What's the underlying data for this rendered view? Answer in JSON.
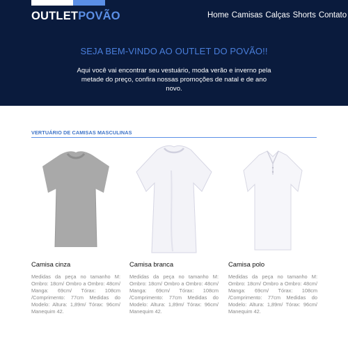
{
  "header": {
    "logo_white": "OUTLET",
    "logo_blue": "POVÃO",
    "nav": [
      "Home",
      "Camisas",
      "Calças",
      "Shorts",
      "Contato"
    ]
  },
  "hero": {
    "welcome": "SEJA BEM-VINDO AO OUTLET DO POVÃO!!",
    "intro": "Aqui você vai encontrar seu vestuário, moda verão e inverno pela metade do preço, confira nossas promoções de natal e de ano novo."
  },
  "section": {
    "title": "VERTUÁRIO DE CAMISAS MASCULINAS"
  },
  "products": [
    {
      "name": "Camisa cinza",
      "description": "Medidas da peça no tamanho M: Ombro: 18cm/ Ombro a Ombro: 48cm/ Manga: 69cm/ Tórax: 108cm /Comprimento: 77cm Medidas do Modelo: Altura: 1,89m/ Tórax: 96cm/ Manequim 42.",
      "image_icon": "gray-tshirt-image"
    },
    {
      "name": "Camisa branca",
      "description": "Medidas da peça no tamanho M: Ombro: 18cm/ Ombro a Ombro: 48cm/ Manga: 69cm/ Tórax: 108cm /Comprimento: 77cm Medidas do Modelo: Altura: 1,89m/ Tórax: 96cm/ Manequim 42.",
      "image_icon": "white-tshirt-image"
    },
    {
      "name": "Camisa polo",
      "description": "Medidas da peça no tamanho M: Ombro: 18cm/ Ombro a Ombro: 48cm/ Manga: 69cm/ Tórax: 108cm /Comprimento: 77cm Medidas do Modelo: Altura: 1,89m/ Tórax: 96cm/ Manequim 42.",
      "image_icon": "polo-shirt-image"
    }
  ],
  "colors": {
    "hero_bg": "#0a1b3d",
    "accent": "#5b8fe6",
    "welcome_text": "#4a7fdc"
  }
}
